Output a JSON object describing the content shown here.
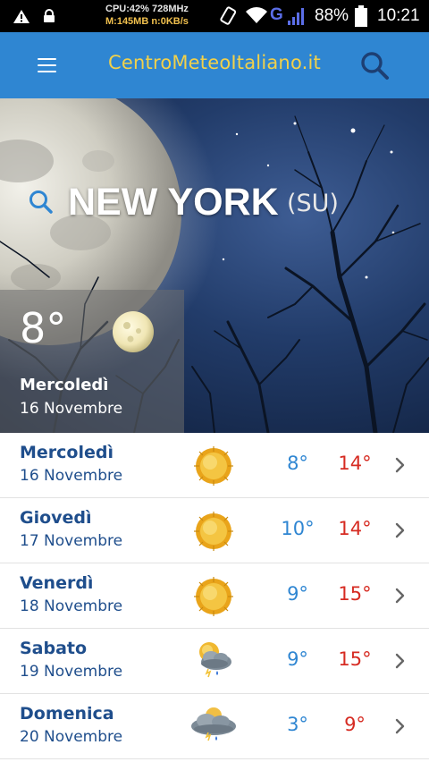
{
  "status_bar": {
    "cpu_line1": "CPU:42% 728MHz",
    "cpu_line2": "M:145MB n:0KB/s",
    "network_label": "G",
    "battery_percent": "88%",
    "time": "10:21",
    "icons": [
      "warning-icon",
      "lock-icon",
      "vibrate-icon",
      "wifi-icon",
      "signal-icon",
      "battery-icon"
    ]
  },
  "app_bar": {
    "title": "CentroMeteoItaliano.it",
    "title_color": "#f2d14a",
    "background_color": "#2f86d2",
    "icons": [
      "hamburger-menu-icon",
      "search-icon"
    ]
  },
  "hero": {
    "city": "NEW YORK",
    "country": "(SU)",
    "today": {
      "temp": "8°",
      "day": "Mercoledì",
      "date": "16 Novembre",
      "icon": "moon-icon"
    }
  },
  "forecast": {
    "min_color": "#2f86d2",
    "max_color": "#d62b22",
    "day_color": "#1f4e8c",
    "rows": [
      {
        "day": "Mercoledì",
        "date": "16 Novembre",
        "icon": "sun-icon",
        "min": "8°",
        "max": "14°"
      },
      {
        "day": "Giovedì",
        "date": "17 Novembre",
        "icon": "sun-icon",
        "min": "10°",
        "max": "14°"
      },
      {
        "day": "Venerdì",
        "date": "18 Novembre",
        "icon": "sun-icon",
        "min": "9°",
        "max": "15°"
      },
      {
        "day": "Sabato",
        "date": "19 Novembre",
        "icon": "sun-cloud-rain-icon",
        "min": "9°",
        "max": "15°"
      },
      {
        "day": "Domenica",
        "date": "20 Novembre",
        "icon": "cloud-rain-icon",
        "min": "3°",
        "max": "9°"
      }
    ]
  }
}
